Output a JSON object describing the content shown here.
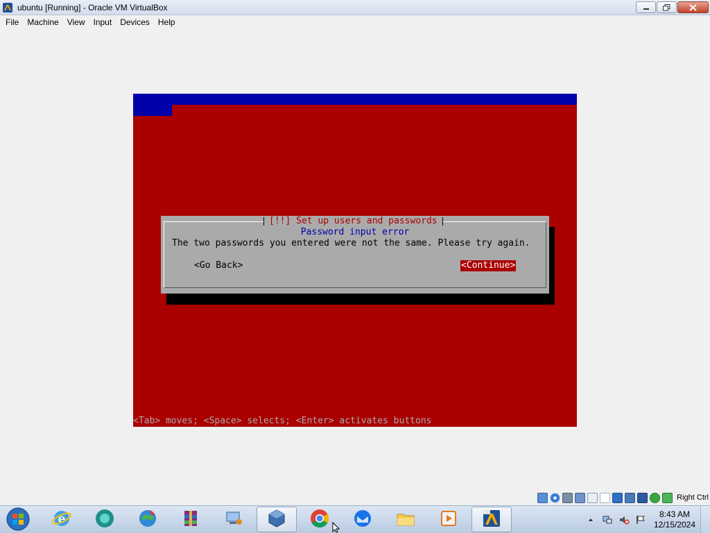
{
  "window": {
    "title": "ubuntu [Running] - Oracle VM VirtualBox",
    "icon": "virtualbox-icon",
    "controls": [
      "minimize-icon",
      "restore-icon",
      "close-icon"
    ]
  },
  "menubar": {
    "items": [
      "File",
      "Machine",
      "View",
      "Input",
      "Devices",
      "Help"
    ]
  },
  "installer": {
    "dialog_title": "[!!] Set up users and passwords",
    "heading": "Password input error",
    "message": "The two passwords you entered were not the same. Please try again.",
    "go_back_label": "<Go Back>",
    "continue_label": "<Continue>",
    "help_line": "<Tab> moves; <Space> selects; <Enter> activates buttons",
    "colors": {
      "background": "#aa0000",
      "top_bar": "#0000aa",
      "dialog": "#aaaaaa",
      "heading": "#0000aa"
    }
  },
  "statusbar": {
    "icons": [
      "hard-disk-icon",
      "optical-drive-icon",
      "audio-icon",
      "network-icon",
      "usb-icon",
      "shared-folder-icon",
      "display-icon",
      "recording-icon",
      "cpu-icon",
      "mouse-integration-icon",
      "keyboard-icon"
    ],
    "host_key": "Right Ctrl"
  },
  "taskbar": {
    "start_icon": "windows-start-icon",
    "apps": [
      {
        "icon": "internet-explorer-icon",
        "active": false
      },
      {
        "icon": "media-app-icon",
        "active": false
      },
      {
        "icon": "network-globe-icon",
        "active": false
      },
      {
        "icon": "winrar-icon",
        "active": false
      },
      {
        "icon": "network-computer-icon",
        "active": false
      },
      {
        "icon": "virtualbox-manager-icon",
        "active": true
      },
      {
        "icon": "chrome-icon",
        "active": false
      },
      {
        "icon": "thunderbird-icon",
        "active": false
      },
      {
        "icon": "file-explorer-icon",
        "active": false
      },
      {
        "icon": "media-player-icon",
        "active": false
      },
      {
        "icon": "virtualbox-vm-icon",
        "active": true
      }
    ],
    "tray_icons": [
      "show-hidden-icons",
      "network-tray-icon",
      "volume-muted-icon",
      "action-center-flag-icon"
    ],
    "time": "8:43 AM",
    "date": "12/15/2024"
  }
}
